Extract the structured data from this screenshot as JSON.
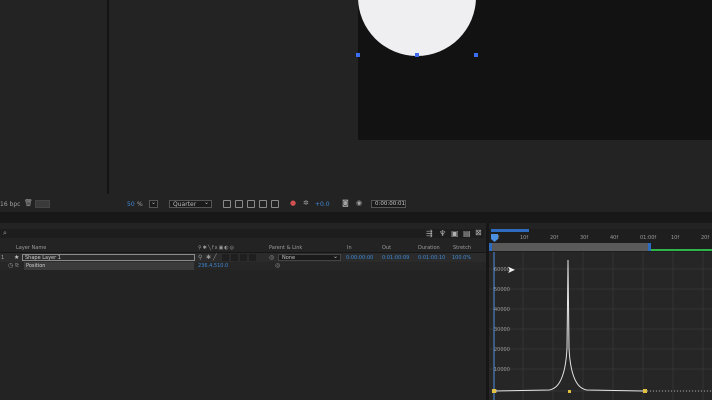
{
  "viewer": {
    "bpc": "16 bpc",
    "zoom_value": "50",
    "zoom_unit": "%",
    "resolution": "Quarter",
    "exposure": "+0.0",
    "timecode": "0:00:00:01"
  },
  "timeline": {
    "columns": {
      "layer_name": "Layer Name",
      "parent_link": "Parent & Link",
      "in": "In",
      "out": "Out",
      "duration": "Duration",
      "stretch": "Stretch"
    },
    "layer": {
      "index": "1",
      "name": "Shape Layer 1",
      "parent": "None",
      "in": "0:00:00:00",
      "out": "0:01:00:09",
      "duration": "0:01:00:10",
      "stretch": "100.0%"
    },
    "property": {
      "name": "Position",
      "value": "236.4,510.0"
    },
    "ruler_labels": [
      "00f",
      "10f",
      "20f",
      "30f",
      "40f",
      "01:00f",
      "10f",
      "20f"
    ],
    "graph_labels": [
      "60000",
      "50000",
      "40000",
      "30000",
      "20000",
      "10000",
      "0"
    ]
  },
  "colors": {
    "accent_blue": "#3e8ad8",
    "curve": "#e6e6e6",
    "keyframe": "#e0c040",
    "work_area_end": "#2fb44a"
  }
}
